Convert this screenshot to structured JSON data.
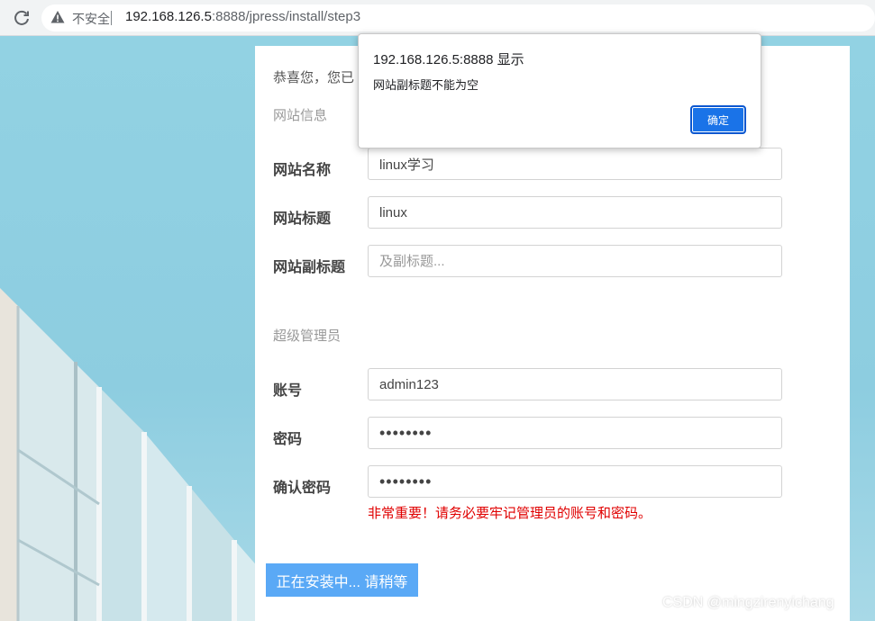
{
  "browser": {
    "insecure_label": "不安全",
    "url_host": "192.168.126.5",
    "url_rest": ":8888/jpress/install/step3"
  },
  "dialog": {
    "title": "192.168.126.5:8888 显示",
    "message": "网站副标题不能为空",
    "ok_label": "确定"
  },
  "page": {
    "intro": "恭喜您，您已",
    "site_section": "网站信息",
    "admin_section": "超级管理员",
    "fields": {
      "site_name": {
        "label": "网站名称",
        "value": "linux学习"
      },
      "site_title": {
        "label": "网站标题",
        "value": "linux"
      },
      "site_subtitle": {
        "label": "网站副标题",
        "value": "",
        "placeholder": "及副标题..."
      },
      "account": {
        "label": "账号",
        "value": "admin123"
      },
      "password": {
        "label": "密码",
        "value": "••••••••"
      },
      "confirm_password": {
        "label": "确认密码",
        "value": "••••••••"
      }
    },
    "warning": "非常重要！请务必要牢记管理员的账号和密码。",
    "install_button": "正在安装中... 请稍等"
  },
  "watermark": "CSDN @mingzirenyichang",
  "colors": {
    "accent": "#1a73e8",
    "install_button": "#5aa9f6",
    "warning": "#e00000",
    "background": "#8ccfe0"
  },
  "icons": [
    "reload-icon",
    "warning-icon"
  ]
}
